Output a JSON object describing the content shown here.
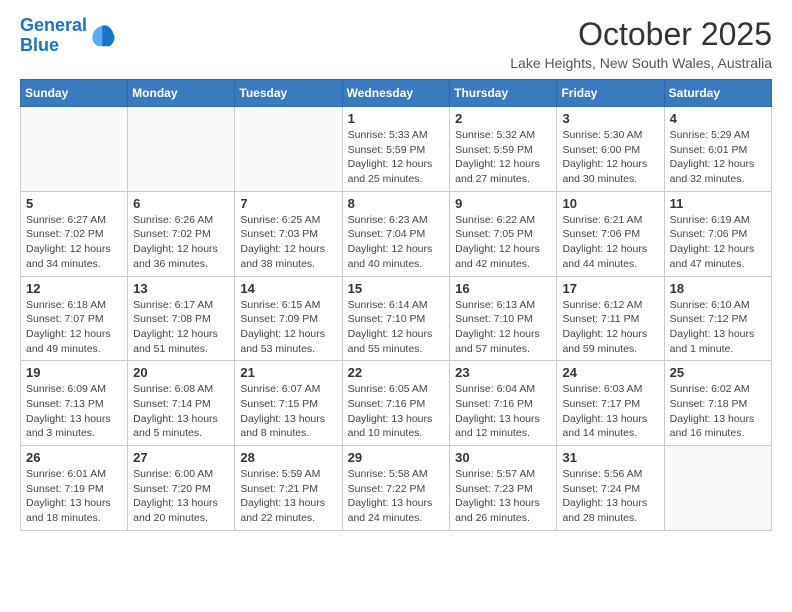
{
  "logo": {
    "line1": "General",
    "line2": "Blue"
  },
  "title": "October 2025",
  "subtitle": "Lake Heights, New South Wales, Australia",
  "weekdays": [
    "Sunday",
    "Monday",
    "Tuesday",
    "Wednesday",
    "Thursday",
    "Friday",
    "Saturday"
  ],
  "weeks": [
    [
      {
        "day": "",
        "info": ""
      },
      {
        "day": "",
        "info": ""
      },
      {
        "day": "",
        "info": ""
      },
      {
        "day": "1",
        "info": "Sunrise: 5:33 AM\nSunset: 5:59 PM\nDaylight: 12 hours\nand 25 minutes."
      },
      {
        "day": "2",
        "info": "Sunrise: 5:32 AM\nSunset: 5:59 PM\nDaylight: 12 hours\nand 27 minutes."
      },
      {
        "day": "3",
        "info": "Sunrise: 5:30 AM\nSunset: 6:00 PM\nDaylight: 12 hours\nand 30 minutes."
      },
      {
        "day": "4",
        "info": "Sunrise: 5:29 AM\nSunset: 6:01 PM\nDaylight: 12 hours\nand 32 minutes."
      }
    ],
    [
      {
        "day": "5",
        "info": "Sunrise: 6:27 AM\nSunset: 7:02 PM\nDaylight: 12 hours\nand 34 minutes."
      },
      {
        "day": "6",
        "info": "Sunrise: 6:26 AM\nSunset: 7:02 PM\nDaylight: 12 hours\nand 36 minutes."
      },
      {
        "day": "7",
        "info": "Sunrise: 6:25 AM\nSunset: 7:03 PM\nDaylight: 12 hours\nand 38 minutes."
      },
      {
        "day": "8",
        "info": "Sunrise: 6:23 AM\nSunset: 7:04 PM\nDaylight: 12 hours\nand 40 minutes."
      },
      {
        "day": "9",
        "info": "Sunrise: 6:22 AM\nSunset: 7:05 PM\nDaylight: 12 hours\nand 42 minutes."
      },
      {
        "day": "10",
        "info": "Sunrise: 6:21 AM\nSunset: 7:06 PM\nDaylight: 12 hours\nand 44 minutes."
      },
      {
        "day": "11",
        "info": "Sunrise: 6:19 AM\nSunset: 7:06 PM\nDaylight: 12 hours\nand 47 minutes."
      }
    ],
    [
      {
        "day": "12",
        "info": "Sunrise: 6:18 AM\nSunset: 7:07 PM\nDaylight: 12 hours\nand 49 minutes."
      },
      {
        "day": "13",
        "info": "Sunrise: 6:17 AM\nSunset: 7:08 PM\nDaylight: 12 hours\nand 51 minutes."
      },
      {
        "day": "14",
        "info": "Sunrise: 6:15 AM\nSunset: 7:09 PM\nDaylight: 12 hours\nand 53 minutes."
      },
      {
        "day": "15",
        "info": "Sunrise: 6:14 AM\nSunset: 7:10 PM\nDaylight: 12 hours\nand 55 minutes."
      },
      {
        "day": "16",
        "info": "Sunrise: 6:13 AM\nSunset: 7:10 PM\nDaylight: 12 hours\nand 57 minutes."
      },
      {
        "day": "17",
        "info": "Sunrise: 6:12 AM\nSunset: 7:11 PM\nDaylight: 12 hours\nand 59 minutes."
      },
      {
        "day": "18",
        "info": "Sunrise: 6:10 AM\nSunset: 7:12 PM\nDaylight: 13 hours\nand 1 minute."
      }
    ],
    [
      {
        "day": "19",
        "info": "Sunrise: 6:09 AM\nSunset: 7:13 PM\nDaylight: 13 hours\nand 3 minutes."
      },
      {
        "day": "20",
        "info": "Sunrise: 6:08 AM\nSunset: 7:14 PM\nDaylight: 13 hours\nand 5 minutes."
      },
      {
        "day": "21",
        "info": "Sunrise: 6:07 AM\nSunset: 7:15 PM\nDaylight: 13 hours\nand 8 minutes."
      },
      {
        "day": "22",
        "info": "Sunrise: 6:05 AM\nSunset: 7:16 PM\nDaylight: 13 hours\nand 10 minutes."
      },
      {
        "day": "23",
        "info": "Sunrise: 6:04 AM\nSunset: 7:16 PM\nDaylight: 13 hours\nand 12 minutes."
      },
      {
        "day": "24",
        "info": "Sunrise: 6:03 AM\nSunset: 7:17 PM\nDaylight: 13 hours\nand 14 minutes."
      },
      {
        "day": "25",
        "info": "Sunrise: 6:02 AM\nSunset: 7:18 PM\nDaylight: 13 hours\nand 16 minutes."
      }
    ],
    [
      {
        "day": "26",
        "info": "Sunrise: 6:01 AM\nSunset: 7:19 PM\nDaylight: 13 hours\nand 18 minutes."
      },
      {
        "day": "27",
        "info": "Sunrise: 6:00 AM\nSunset: 7:20 PM\nDaylight: 13 hours\nand 20 minutes."
      },
      {
        "day": "28",
        "info": "Sunrise: 5:59 AM\nSunset: 7:21 PM\nDaylight: 13 hours\nand 22 minutes."
      },
      {
        "day": "29",
        "info": "Sunrise: 5:58 AM\nSunset: 7:22 PM\nDaylight: 13 hours\nand 24 minutes."
      },
      {
        "day": "30",
        "info": "Sunrise: 5:57 AM\nSunset: 7:23 PM\nDaylight: 13 hours\nand 26 minutes."
      },
      {
        "day": "31",
        "info": "Sunrise: 5:56 AM\nSunset: 7:24 PM\nDaylight: 13 hours\nand 28 minutes."
      },
      {
        "day": "",
        "info": ""
      }
    ]
  ]
}
